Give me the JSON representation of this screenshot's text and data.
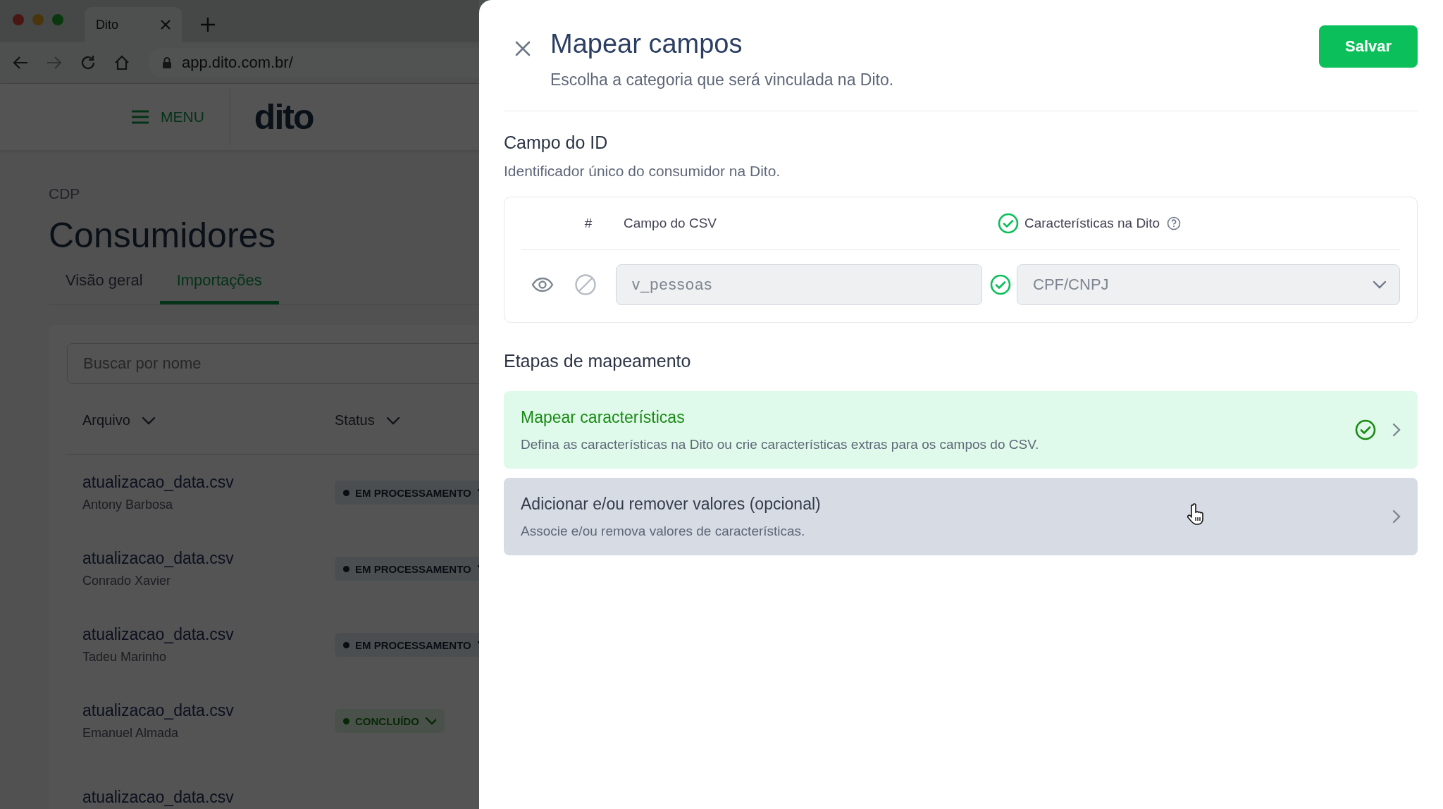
{
  "browser": {
    "tab_title": "Dito",
    "url": "app.dito.com.br/"
  },
  "app_header": {
    "menu_label": "MENU",
    "logo": "dito"
  },
  "page": {
    "breadcrumb": "CDP",
    "title": "Consumidores",
    "tabs": [
      {
        "label": "Visão geral",
        "selected": false
      },
      {
        "label": "Importações",
        "selected": true
      }
    ],
    "search": {
      "placeholder": "Buscar por nome"
    },
    "table": {
      "columns": [
        "Arquivo",
        "Status"
      ],
      "rows": [
        {
          "file": "atualizacao_data.csv",
          "author": "Antony Barbosa",
          "status": "EM PROCESSAMENTO",
          "kind": "processing"
        },
        {
          "file": "atualizacao_data.csv",
          "author": "Conrado Xavier",
          "status": "EM PROCESSAMENTO",
          "kind": "processing"
        },
        {
          "file": "atualizacao_data.csv",
          "author": "Tadeu Marinho",
          "status": "EM PROCESSAMENTO",
          "kind": "processing"
        },
        {
          "file": "atualizacao_data.csv",
          "author": "Emanuel Almada",
          "status": "CONCLUÍDO",
          "kind": "done"
        },
        {
          "file": "atualizacao_data.csv"
        }
      ]
    }
  },
  "panel": {
    "title": "Mapear campos",
    "subtitle": "Escolha a categoria que será vinculada na Dito.",
    "save_button": "Salvar",
    "id_section": {
      "title": "Campo do ID",
      "description": "Identificador único do consumidor na Dito.",
      "columns": {
        "number": "#",
        "csv": "Campo do CSV",
        "dito": "Características na Dito"
      },
      "header_valid": true,
      "row": {
        "visible": true,
        "csv_field": "v_pessoas",
        "valid": true,
        "dito_field": "CPF/CNPJ"
      }
    },
    "steps_title": "Etapas de mapeamento",
    "steps": [
      {
        "title": "Mapear características",
        "description": "Defina as características na Dito ou crie características extras para os campos do CSV.",
        "completed": true,
        "hovered": false
      },
      {
        "title": "Adicionar e/ou remover valores (opcional)",
        "description": "Associe e/ou remova valores de características.",
        "completed": false,
        "hovered": true
      }
    ]
  }
}
